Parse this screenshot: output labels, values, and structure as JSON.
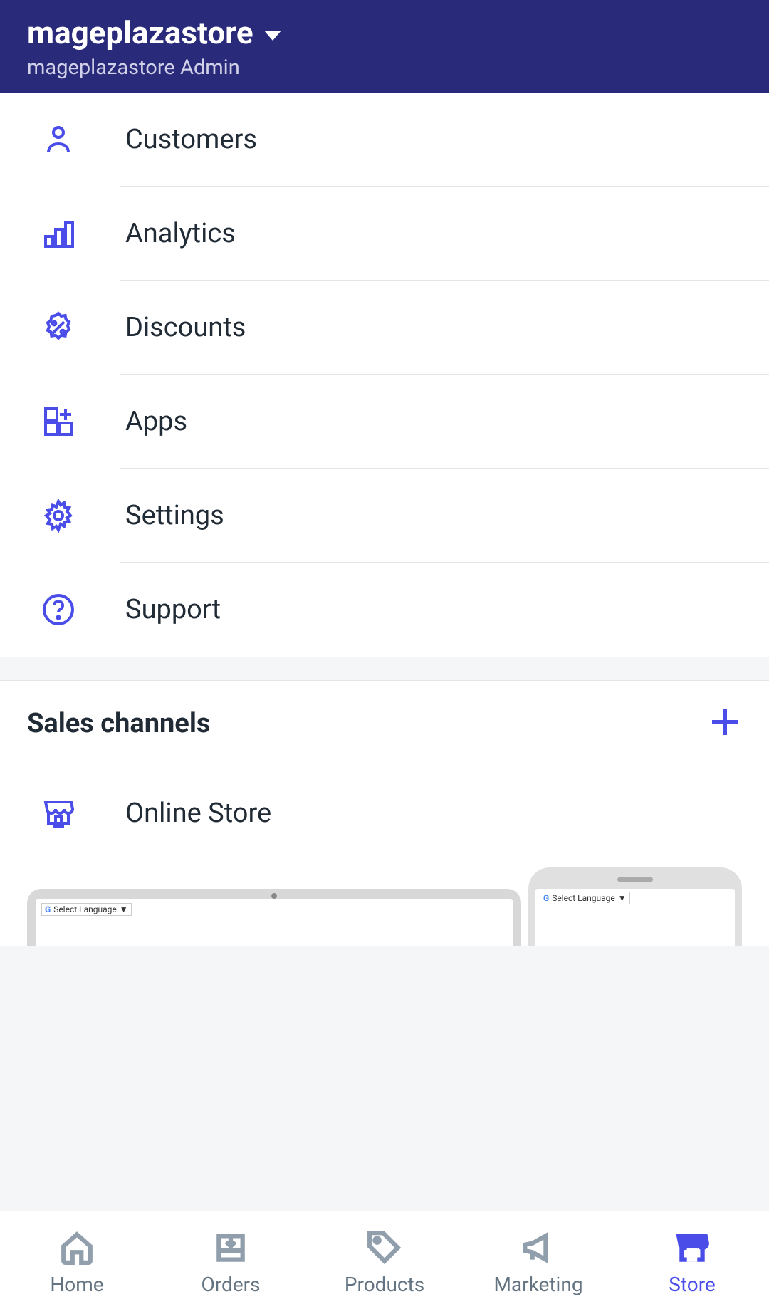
{
  "header": {
    "store_name": "mageplazastore",
    "admin_label": "mageplazastore Admin"
  },
  "menu": {
    "items": [
      {
        "label": "Customers",
        "icon": "person-icon"
      },
      {
        "label": "Analytics",
        "icon": "bar-chart-icon"
      },
      {
        "label": "Discounts",
        "icon": "discount-icon"
      },
      {
        "label": "Apps",
        "icon": "apps-icon"
      },
      {
        "label": "Settings",
        "icon": "gear-icon"
      },
      {
        "label": "Support",
        "icon": "help-icon"
      }
    ]
  },
  "sales_channels": {
    "title": "Sales channels",
    "items": [
      {
        "label": "Online Store",
        "icon": "store-icon"
      }
    ]
  },
  "preview": {
    "lang_select": "Select Language"
  },
  "tabs": {
    "items": [
      {
        "label": "Home",
        "icon": "home-icon",
        "active": false
      },
      {
        "label": "Orders",
        "icon": "orders-icon",
        "active": false
      },
      {
        "label": "Products",
        "icon": "tag-icon",
        "active": false
      },
      {
        "label": "Marketing",
        "icon": "megaphone-icon",
        "active": false
      },
      {
        "label": "Store",
        "icon": "store-icon",
        "active": true
      }
    ]
  },
  "colors": {
    "accent": "#4a4de8",
    "header_bg": "#2a2a7a"
  }
}
